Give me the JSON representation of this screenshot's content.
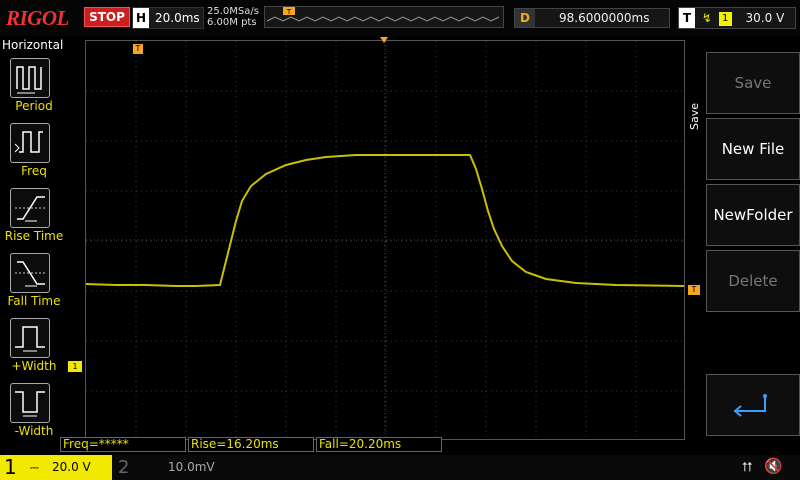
{
  "topbar": {
    "brand_main": "RIGOL",
    "run_state": "STOP",
    "timebase_label": "H",
    "timebase_value": "20.0ms",
    "sample_rate": "25.0MSa/s",
    "memory_depth": "6.00M pts",
    "delay_label": "D",
    "delay_value": "98.6000000ms",
    "trigger_label": "T",
    "trigger_source": "1",
    "trigger_level": "30.0 V"
  },
  "left_panel": {
    "title": "Horizontal",
    "items": [
      {
        "label": "Period",
        "icon": "period-icon"
      },
      {
        "label": "Freq",
        "icon": "freq-icon"
      },
      {
        "label": "Rise Time",
        "icon": "rise-time-icon"
      },
      {
        "label": "Fall Time",
        "icon": "fall-time-icon"
      },
      {
        "label": "+Width",
        "icon": "pos-width-icon"
      },
      {
        "label": "-Width",
        "icon": "neg-width-icon"
      }
    ]
  },
  "right_menu": {
    "title": "Save",
    "buttons": [
      {
        "label": "Save",
        "enabled": false
      },
      {
        "label": "New File",
        "enabled": true
      },
      {
        "label": "NewFolder",
        "enabled": true
      },
      {
        "label": "Delete",
        "enabled": false
      }
    ],
    "return_icon": "return-icon"
  },
  "measurements": {
    "freq": "Freq=*****",
    "rise": "Rise=16.20ms",
    "fall": "Fall=20.20ms"
  },
  "channels": {
    "ch1_number": "1",
    "ch1_scale": "20.0 V",
    "ch2_number": "2",
    "ch2_scale": "10.0mV"
  },
  "markers": {
    "trigger_marker": "T",
    "ch1_marker": "1"
  },
  "colors": {
    "trace": "#c8c000",
    "ch1": "#f2e900",
    "trigger": "#f5a623",
    "stop": "#cc1f1f"
  }
}
